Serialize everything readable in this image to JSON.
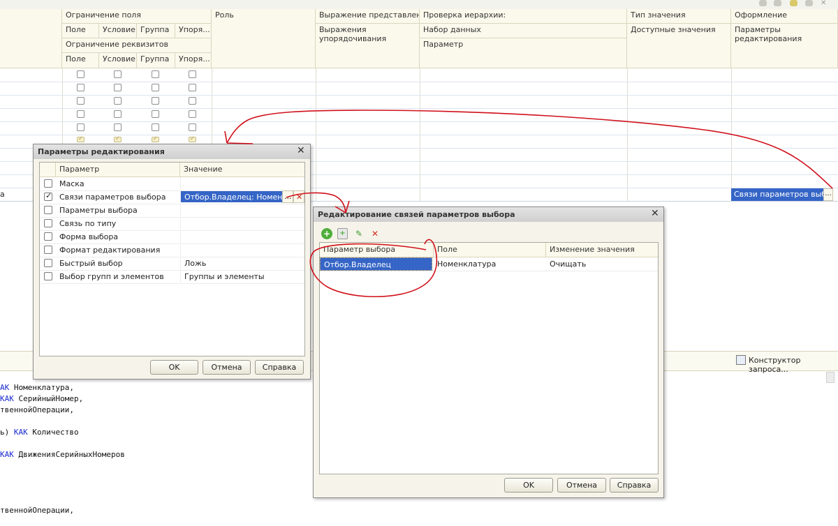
{
  "grid": {
    "headers": {
      "field_restriction": "Ограничение поля",
      "role": "Роль",
      "presentation_expr": "Выражение представления",
      "hierarchy_check": "Проверка иерархии:",
      "value_type": "Тип значения",
      "appearance": "Оформление",
      "field": "Поле",
      "condition": "Условие",
      "group": "Группа",
      "ordering": "Упоря...",
      "order_exprs": "Выражения упорядочивания",
      "dataset": "Набор данных",
      "parameter": "Параметр",
      "available_values": "Доступные значения",
      "edit_params": "Параметры редактирования",
      "attr_restriction": "Ограничение реквизитов",
      "field2": "Поле",
      "condition2": "Условие",
      "group2": "Группа",
      "ordering2": "Упоря..."
    },
    "selected_row_left_text": "а",
    "selected_cell": "Связи параметров выбор",
    "ellipsis": "..."
  },
  "bottom": {
    "query_builder": "Конструктор запроса..."
  },
  "code_lines": [
    {
      "pre": "",
      "kw": "АК",
      "post": " Номенклатура,"
    },
    {
      "pre": "",
      "kw": "КАК",
      "post": " СерийныйНомер,"
    },
    {
      "pre": "твенной",
      "kw": "",
      "post": "Операции,"
    },
    {
      "pre": "ь) ",
      "kw": "КАК",
      "post": " Количество"
    },
    {
      "pre": "",
      "kw": "КАК",
      "post": " ДвиженияСерийныхНомеров"
    },
    {
      "pre": "твенной",
      "kw": "",
      "post": "Операции,"
    }
  ],
  "dialog1": {
    "title": "Параметры редактирования",
    "col_param": "Параметр",
    "col_value": "Значение",
    "rows": [
      {
        "label": "Маска",
        "value": "",
        "checked": false
      },
      {
        "label": "Связи параметров выбора",
        "value": "Отбор.Владелец: Номенкла",
        "checked": true
      },
      {
        "label": "Параметры выбора",
        "value": "",
        "checked": false
      },
      {
        "label": "Связь по типу",
        "value": "",
        "checked": false
      },
      {
        "label": "Форма выбора",
        "value": "",
        "checked": false
      },
      {
        "label": "Формат редактирования",
        "value": "",
        "checked": false
      },
      {
        "label": "Быстрый выбор",
        "value": "Ложь",
        "checked": false
      },
      {
        "label": "Выбор групп и элементов",
        "value": "Группы и элементы",
        "checked": false
      }
    ],
    "ellipsis": "...",
    "clear": "✕",
    "ok": "OK",
    "cancel": "Отмена",
    "help": "Справка"
  },
  "dialog2": {
    "title": "Редактирование связей параметров выбора",
    "col_choice_param": "Параметр выбора",
    "col_field": "Поле",
    "col_change": "Изменение значения",
    "rows": [
      {
        "param": "Отбор.Владелец",
        "field": "Номенклатура",
        "change": "Очищать"
      }
    ],
    "ok": "OK",
    "cancel": "Отмена",
    "help": "Справка"
  },
  "colors": {
    "selection": "#3565c6",
    "header_bg": "#fbf9ec",
    "annotation": "#d0101a"
  }
}
